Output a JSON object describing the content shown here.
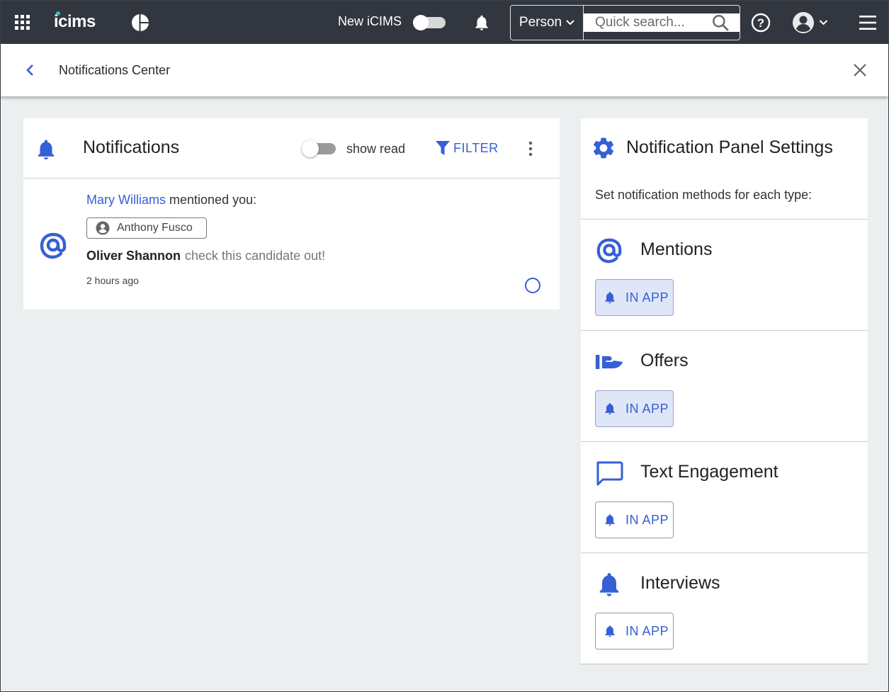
{
  "colors": {
    "accent": "#3560d6",
    "nav_bg": "#31363f",
    "page_bg": "#eceff0",
    "active_btn_bg": "#dfe6f8"
  },
  "topnav": {
    "logo_text": "icims",
    "new_icims_label": "New iCIMS",
    "new_icims_toggle_on": false,
    "search_type": "Person",
    "search_placeholder": "Quick search...",
    "search_value": "",
    "icons": [
      "apps-grid-icon",
      "analytics-pie-icon",
      "bell-icon",
      "chevron-down-icon",
      "search-icon",
      "help-icon",
      "user-avatar-icon",
      "hamburger-menu-icon"
    ]
  },
  "subheader": {
    "title": "Notifications Center",
    "icons": [
      "back-chevron-icon",
      "close-icon"
    ]
  },
  "notifications": {
    "title": "Notifications",
    "show_read_label": "show read",
    "show_read_on": false,
    "filter_label": "FILTER",
    "items": [
      {
        "type_icon": "at-mention-icon",
        "actor": "Mary Williams",
        "action": "mentioned you:",
        "chip_label": "Anthony Fusco",
        "author": "Oliver Shannon",
        "message": "check this candidate out!",
        "time": "2 hours ago",
        "read": false
      }
    ]
  },
  "settings": {
    "title": "Notification Panel Settings",
    "subtitle": "Set notification methods for each type:",
    "types": [
      {
        "name": "Mentions",
        "icon": "at-mention-icon",
        "method_label": "IN APP",
        "enabled": true
      },
      {
        "name": "Offers",
        "icon": "offer-hand-icon",
        "method_label": "IN APP",
        "enabled": true
      },
      {
        "name": "Text Engagement",
        "icon": "chat-bubble-icon",
        "method_label": "IN APP",
        "enabled": false
      },
      {
        "name": "Interviews",
        "icon": "bell-icon",
        "method_label": "IN APP",
        "enabled": false
      }
    ]
  }
}
